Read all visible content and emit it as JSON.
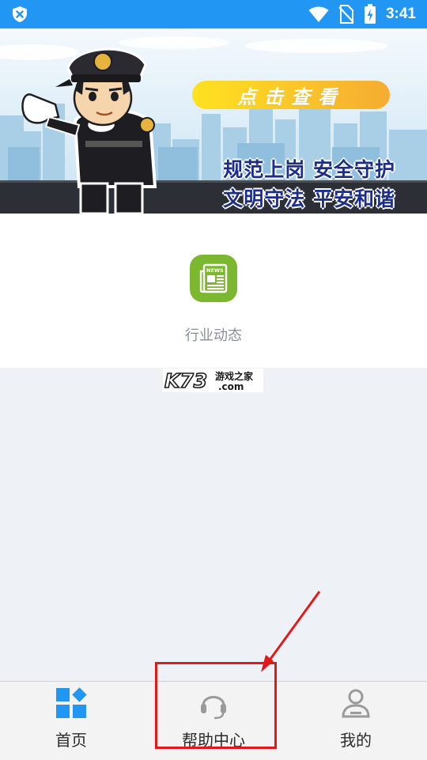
{
  "status_bar": {
    "time": "3:41",
    "icons": [
      "shield-x-icon",
      "wifi-icon",
      "no-sim-icon",
      "battery-charging-icon"
    ]
  },
  "banner": {
    "cta_label": "点击查看",
    "slogan_line1": "规范上岗 安全守护",
    "slogan_line2": "文明守法 平安和谐",
    "slides_count": 2,
    "active_slide": 2
  },
  "features": [
    {
      "label": "行业动态",
      "icon": "news-icon",
      "icon_text": "NEWS",
      "color": "#7cb82f"
    }
  ],
  "watermark": {
    "brand": "K73",
    "tagline": "游戏之家",
    "domain": ".com"
  },
  "bottom_nav": {
    "items": [
      {
        "label": "首页",
        "icon": "home-grid-icon",
        "active": true
      },
      {
        "label": "帮助中心",
        "icon": "headset-icon",
        "active": false
      },
      {
        "label": "我的",
        "icon": "user-icon",
        "active": false
      }
    ]
  },
  "colors": {
    "status_bar": "#2196f3",
    "accent": "#2196f3",
    "news_green": "#7cb82f",
    "annotation_red": "#e01919"
  }
}
